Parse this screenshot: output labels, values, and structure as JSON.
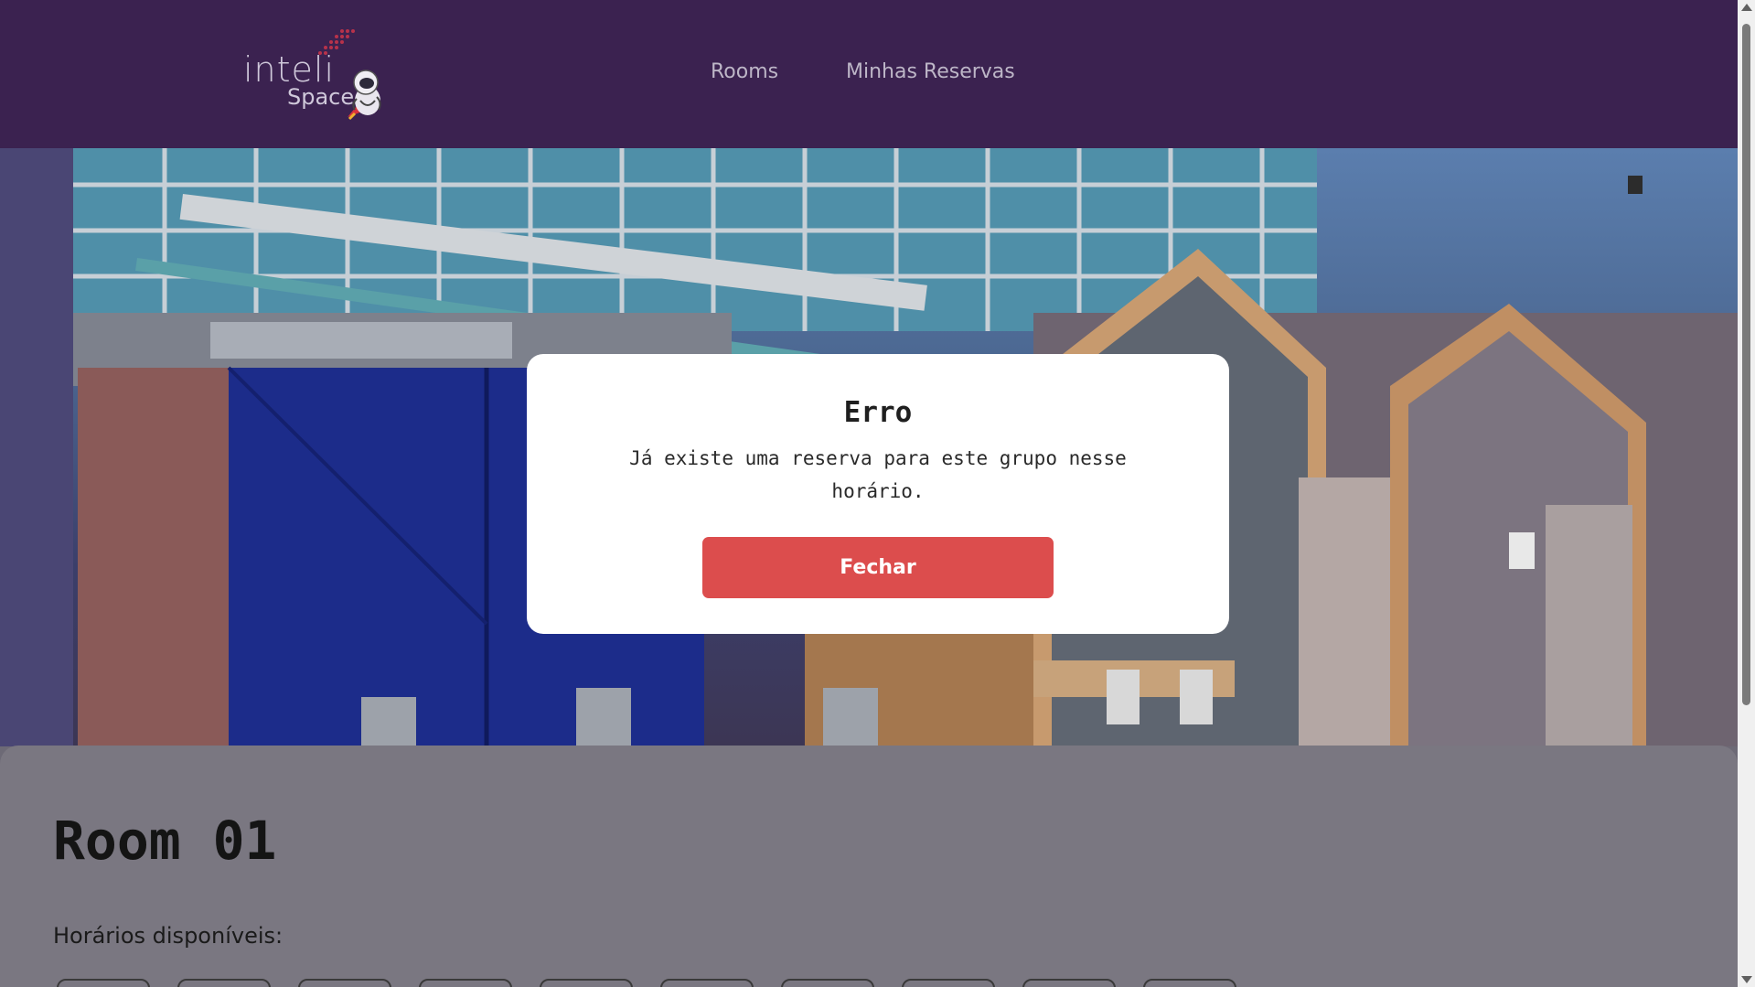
{
  "header": {
    "logo_word": "inteli",
    "logo_sub": "Space",
    "nav": [
      {
        "label": "Rooms"
      },
      {
        "label": "Minhas Reservas"
      }
    ]
  },
  "room": {
    "title": "Room 01",
    "horarios_label": "Horários disponíveis:"
  },
  "modal": {
    "title": "Erro",
    "message": "Já existe uma reserva para este grupo nesse horário.",
    "close_label": "Fechar"
  },
  "colors": {
    "header_bg": "#3b2250",
    "button_red": "#dc4d4d",
    "modal_bg": "#ffffff"
  }
}
